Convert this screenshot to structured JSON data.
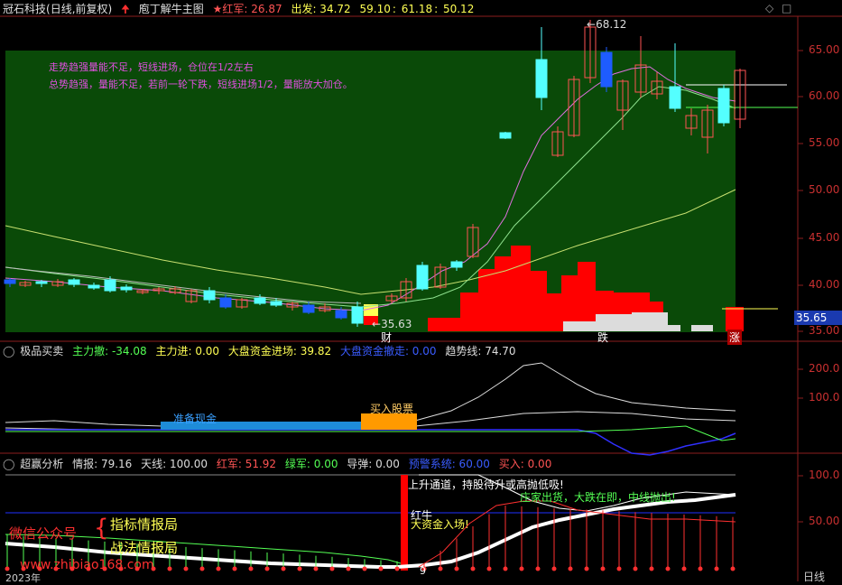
{
  "main_header": {
    "stock": "冠石科技",
    "period": "(日线,前复权)",
    "indicator": "庖丁解牛主图",
    "star_label": "★红军: 26.87",
    "out_label": "出发: 34.72",
    "v1": "59.10",
    "v2": "61.18",
    "v3": "50.12",
    "sep": ":"
  },
  "main_notes": [
    "走势趋强量能不足，短线进场，仓位在1/2左右",
    "总势趋强，量能不足，若前一轮下跌，短线进场1/2，量能放大加仓。"
  ],
  "main_axis": {
    "ticks": [
      "65.00",
      "60.00",
      "55.00",
      "50.00",
      "45.00",
      "40.00",
      "35.00"
    ],
    "current": "35.65"
  },
  "main_labels": {
    "high": "68.12",
    "low": "35.63",
    "cai": "财",
    "die": "跌",
    "zhang": "涨"
  },
  "p2_header": {
    "name": "极品买卖",
    "a": "主力撤: -34.08",
    "b": "主力进: 0.00",
    "c": "大盘资金进场: 39.82",
    "d": "大盘资金撤走: 0.00",
    "e": "趋势线: 74.70"
  },
  "p2_axis": {
    "ticks": [
      "200.0",
      "100.0"
    ]
  },
  "p2_labels": {
    "prep": "准备现金",
    "buy": "买入股票"
  },
  "p3_header": {
    "name": "超赢分析",
    "a": "情报: 79.16",
    "b": "天线: 100.00",
    "c": "红军: 51.92",
    "d": "绿军: 0.00",
    "e": "导弹: 0.00",
    "f": "预警系统: 60.00",
    "g": "买入: 0.00"
  },
  "p3_axis": {
    "ticks": [
      "100.0",
      "50.00"
    ]
  },
  "p3_labels": {
    "channel": "上升通道，持股待升或高抛低吸!",
    "zhuang": "庄家出货，大跌在即，中线抛出!",
    "hong": "红牛",
    "funds": "大资金入场!"
  },
  "watermark": {
    "l1": "微信公众号",
    "l2": "指标情报局",
    "l3": "战法情报局",
    "url": "www.zhibiao168.com"
  },
  "footer": {
    "year": "2023年",
    "mark": "9",
    "tab": "日线"
  },
  "colors": {
    "green_bg": "#0a4a08",
    "red": "#ff0000",
    "cyan": "#54ffff",
    "blue": "#1e5cff",
    "yellow": "#ffff54",
    "magenta": "#ff54ff"
  }
}
